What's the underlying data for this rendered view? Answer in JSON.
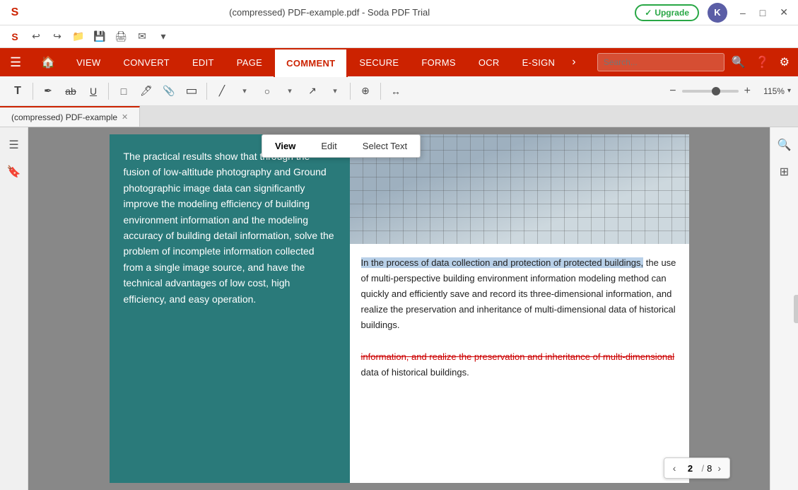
{
  "titlebar": {
    "title": "(compressed)  PDF-example.pdf  -  Soda PDF Trial",
    "upgrade_label": "Upgrade",
    "avatar_label": "K",
    "win_minimize": "–",
    "win_restore": "□",
    "win_close": "✕"
  },
  "icon_toolbar": {
    "icons": [
      "S",
      "↩",
      "↪",
      "📁",
      "💾",
      "🖨",
      "✉",
      "▾"
    ]
  },
  "menu": {
    "items": [
      {
        "id": "hamburger",
        "label": "☰"
      },
      {
        "id": "home",
        "label": "🏠"
      },
      {
        "id": "view",
        "label": "VIEW"
      },
      {
        "id": "convert",
        "label": "CONVERT"
      },
      {
        "id": "edit",
        "label": "EDIT"
      },
      {
        "id": "page",
        "label": "PAGE"
      },
      {
        "id": "comment",
        "label": "COMMENT"
      },
      {
        "id": "secure",
        "label": "SECURE"
      },
      {
        "id": "forms",
        "label": "FORMS"
      },
      {
        "id": "ocr",
        "label": "OCR"
      },
      {
        "id": "esign",
        "label": "E-SIGN"
      },
      {
        "id": "more",
        "label": "›"
      }
    ],
    "search_placeholder": "Search...",
    "active_item": "comment"
  },
  "annotation_bar": {
    "tools": [
      {
        "id": "text",
        "icon": "T",
        "label": "Text"
      },
      {
        "id": "pen",
        "icon": "✒",
        "label": "Pen"
      },
      {
        "id": "strikethrough",
        "icon": "ab̶",
        "label": "Strikethrough"
      },
      {
        "id": "underline",
        "icon": "U̲",
        "label": "Underline"
      },
      {
        "id": "note",
        "icon": "□",
        "label": "Note"
      },
      {
        "id": "highlight",
        "icon": "🖊",
        "label": "Highlight"
      },
      {
        "id": "attachment",
        "icon": "📎",
        "label": "Attachment"
      },
      {
        "id": "stamp",
        "icon": "▭",
        "label": "Stamp"
      },
      {
        "id": "line",
        "icon": "╱",
        "label": "Line"
      },
      {
        "id": "line-dropdown",
        "icon": "▾",
        "label": ""
      },
      {
        "id": "ellipse",
        "icon": "○",
        "label": "Ellipse"
      },
      {
        "id": "ellipse-dropdown",
        "icon": "▾",
        "label": ""
      },
      {
        "id": "arrow",
        "icon": "↗",
        "label": "Arrow"
      },
      {
        "id": "arrow-dropdown",
        "icon": "▾",
        "label": ""
      },
      {
        "id": "cursor",
        "icon": "⊕",
        "label": "Cursor"
      },
      {
        "id": "arrow-resize",
        "icon": "↔",
        "label": "Resize"
      }
    ],
    "zoom": {
      "minus": "−",
      "plus": "+",
      "value": "115%",
      "dropdown": "▾",
      "slider_percent": 60
    }
  },
  "tab": {
    "label": "(compressed)  PDF-example",
    "close": "✕"
  },
  "context_menu": {
    "items": [
      {
        "id": "view",
        "label": "View"
      },
      {
        "id": "edit",
        "label": "Edit"
      },
      {
        "id": "select_text",
        "label": "Select Text"
      }
    ],
    "active": "view"
  },
  "pdf_content": {
    "left_column_text": "The practical results show that through the fusion of low-altitude photography and Ground photographic image data can significantly improve the modeling efficiency of building environment information and the modeling accuracy of building detail information, solve the problem of incomplete information collected from a single image source, and have the technical advantages of low cost, high efficiency, and easy operation.",
    "right_text_normal": " the use of multi-perspective building environment information modeling method can quickly and efficiently save and record its three-dimensional information, and realize the preservation and inheritance of multi-dimensional data of historical buildings.",
    "right_text_highlighted": "In the process of data collection and protection of protected buildings,",
    "right_text_strikethrough": "information, and realize the preservation and inheritance of multi-dimensional",
    "right_text_after": "data of historical buildings."
  },
  "page_nav": {
    "prev": "‹",
    "next": "›",
    "current": "2",
    "separator": "/",
    "total": "8"
  },
  "sidebar_right": {
    "search_icon": "🔍",
    "panel_icon": "⊞"
  }
}
